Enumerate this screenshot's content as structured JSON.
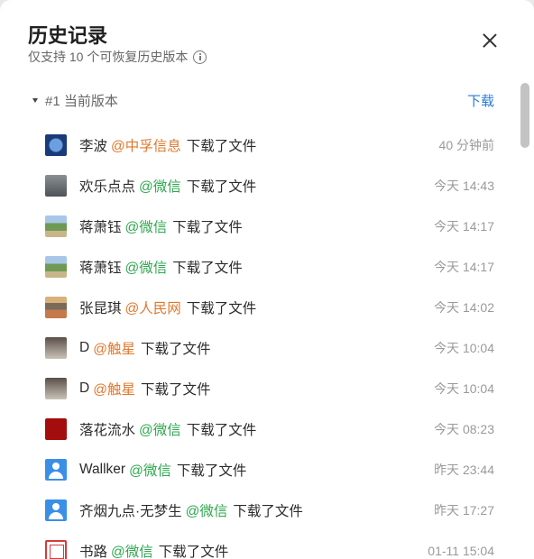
{
  "header": {
    "title": "历史记录",
    "subtitle": "仅支持 10 个可恢复历史版本"
  },
  "version": {
    "label": "#1 当前版本",
    "download_label": "下载"
  },
  "colors": {
    "source_orange": "#e0782c",
    "source_green": "#2fa84f",
    "link_blue": "#2a7ad8"
  },
  "entries": [
    {
      "name": "李波",
      "source": "@中孚信息",
      "source_color": "orange",
      "action": "下载了文件",
      "time": "40 分钟前",
      "avatar": "globe-avatar"
    },
    {
      "name": "欢乐点点",
      "source": "@微信",
      "source_color": "green",
      "action": "下载了文件",
      "time": "今天 14:43",
      "avatar": "group-avatar"
    },
    {
      "name": "蒋萧钰",
      "source": "@微信",
      "source_color": "green",
      "action": "下载了文件",
      "time": "今天 14:17",
      "avatar": "field-avatar"
    },
    {
      "name": "蒋萧钰",
      "source": "@微信",
      "source_color": "green",
      "action": "下载了文件",
      "time": "今天 14:17",
      "avatar": "field-avatar"
    },
    {
      "name": "张昆琪",
      "source": "@人民网",
      "source_color": "orange",
      "action": "下载了文件",
      "time": "今天 14:02",
      "avatar": "people-avatar"
    },
    {
      "name": "D",
      "source": "@触星",
      "source_color": "orange",
      "action": "下载了文件",
      "time": "今天 10:04",
      "avatar": "bird-avatar"
    },
    {
      "name": "D",
      "source": "@触星",
      "source_color": "orange",
      "action": "下载了文件",
      "time": "今天 10:04",
      "avatar": "bird-avatar"
    },
    {
      "name": "落花流水",
      "source": "@微信",
      "source_color": "green",
      "action": "下载了文件",
      "time": "今天 08:23",
      "avatar": "red-avatar"
    },
    {
      "name": "Wallker",
      "source": "@微信",
      "source_color": "green",
      "action": "下载了文件",
      "time": "昨天 23:44",
      "avatar": "user-avatar"
    },
    {
      "name": "齐烟九点·无梦生",
      "source": "@微信",
      "source_color": "green",
      "action": "下载了文件",
      "time": "昨天 17:27",
      "avatar": "user-avatar"
    },
    {
      "name": "书路",
      "source": "@微信",
      "source_color": "green",
      "action": "下载了文件",
      "time": "01-11 15:04",
      "avatar": "stamp-avatar"
    }
  ]
}
